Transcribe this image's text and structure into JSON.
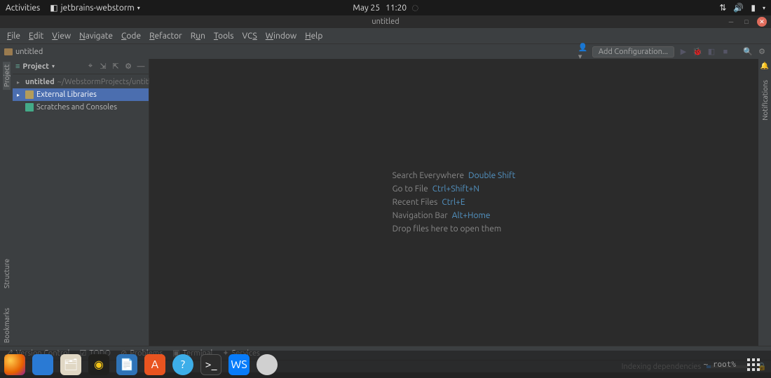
{
  "gnome": {
    "activities": "Activities",
    "app_name": "jetbrains-webstorm",
    "date": "May 25",
    "time": "11:20"
  },
  "window": {
    "title": "untitled"
  },
  "menubar": [
    "File",
    "Edit",
    "View",
    "Navigate",
    "Code",
    "Refactor",
    "Run",
    "Tools",
    "VCS",
    "Window",
    "Help"
  ],
  "breadcrumb": {
    "project": "untitled"
  },
  "toolbar": {
    "add_configuration": "Add Configuration..."
  },
  "project_panel": {
    "title": "Project",
    "tree": {
      "root_name": "untitled",
      "root_path": "~/WebstormProjects/untitled",
      "external_libs": "External Libraries",
      "scratches": "Scratches and Consoles"
    }
  },
  "left_tabs": {
    "project": "Project",
    "structure": "Structure",
    "bookmarks": "Bookmarks"
  },
  "right_tabs": {
    "notifications": "Notifications"
  },
  "editor_hints": {
    "l1_label": "Search Everywhere",
    "l1_short": "Double Shift",
    "l2_label": "Go to File",
    "l2_short": "Ctrl+Shift+N",
    "l3_label": "Recent Files",
    "l3_short": "Ctrl+E",
    "l4_label": "Navigation Bar",
    "l4_short": "Alt+Home",
    "l5_label": "Drop files here to open them"
  },
  "bottom_tabs": {
    "vcs": "Version Control",
    "todo": "TODO",
    "problems": "Problems",
    "terminal": "Terminal",
    "services": "Services"
  },
  "status": {
    "indexing": "Indexing dependencies",
    "root": "~ root%"
  }
}
